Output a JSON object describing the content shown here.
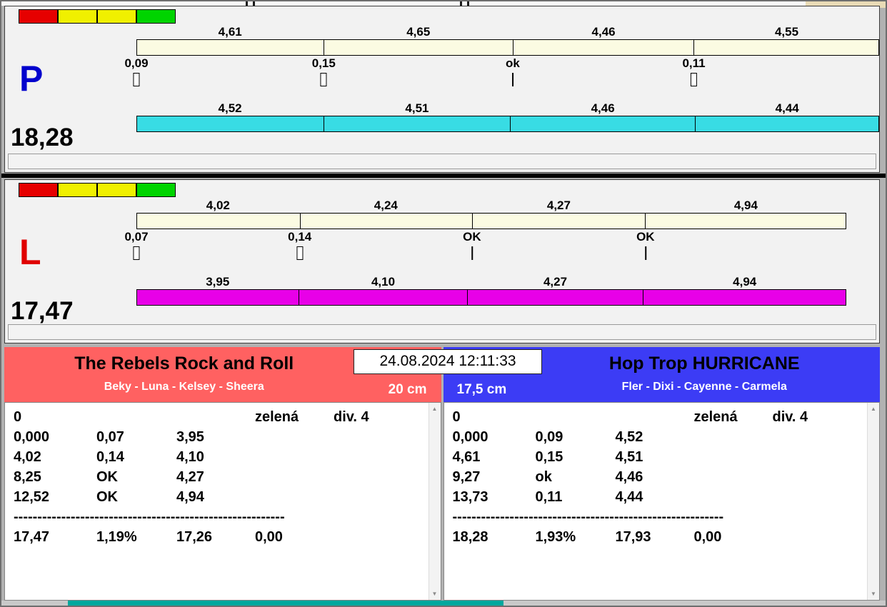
{
  "chrome": {
    "timestamp": "24.08.2024 12:11:33"
  },
  "max_total": 18.28,
  "lanes": [
    {
      "letter": "P",
      "letter_color": "#0101cd",
      "total_display": "18,28",
      "total": 18.28,
      "split_bar_color": "#fbfbe2",
      "dog_bar_color": "#38dce4",
      "status_colors": [
        "#e60000",
        "#f0f000",
        "#f0f000",
        "#00d400"
      ],
      "splits": [
        {
          "label": "4,61",
          "value": 4.61
        },
        {
          "label": "4,65",
          "value": 4.65
        },
        {
          "label": "4,46",
          "value": 4.46
        },
        {
          "label": "4,55",
          "value": 4.55
        }
      ],
      "changes": [
        {
          "label": "0,09",
          "tick": "box"
        },
        {
          "label": "0,15",
          "tick": "box"
        },
        {
          "label": "ok",
          "tick": "line"
        },
        {
          "label": "0,11",
          "tick": "box"
        }
      ],
      "dogs": [
        {
          "label": "4,52",
          "value": 4.52
        },
        {
          "label": "4,51",
          "value": 4.51
        },
        {
          "label": "4,46",
          "value": 4.46
        },
        {
          "label": "4,44",
          "value": 4.44
        }
      ]
    },
    {
      "letter": "L",
      "letter_color": "#e00000",
      "total_display": "17,47",
      "total": 17.47,
      "split_bar_color": "#fbfbe2",
      "dog_bar_color": "#e800e8",
      "status_colors": [
        "#e60000",
        "#f0f000",
        "#f0f000",
        "#00d400"
      ],
      "splits": [
        {
          "label": "4,02",
          "value": 4.02
        },
        {
          "label": "4,24",
          "value": 4.24
        },
        {
          "label": "4,27",
          "value": 4.27
        },
        {
          "label": "4,94",
          "value": 4.94
        }
      ],
      "changes": [
        {
          "label": "0,07",
          "tick": "box"
        },
        {
          "label": "0,14",
          "tick": "box"
        },
        {
          "label": "OK",
          "tick": "line"
        },
        {
          "label": "OK",
          "tick": "line"
        }
      ],
      "dogs": [
        {
          "label": "3,95",
          "value": 3.95
        },
        {
          "label": "4,10",
          "value": 4.1
        },
        {
          "label": "4,27",
          "value": 4.27
        },
        {
          "label": "4,94",
          "value": 4.94
        }
      ]
    }
  ],
  "teams": [
    {
      "name": "The Rebels Rock and Roll",
      "members": "Beky - Luna - Kelsey - Sheera",
      "height": "20 cm",
      "header_color": "#ff6161",
      "table": {
        "info": {
          "c1": "0",
          "c4": "zelená",
          "c5": "div. 4"
        },
        "rows": [
          [
            "0,000",
            "0,07",
            "3,95"
          ],
          [
            "4,02",
            "0,14",
            "4,10"
          ],
          [
            "8,25",
            "OK",
            "4,27"
          ],
          [
            "12,52",
            "OK",
            "4,94"
          ]
        ],
        "divider": "---------------------------------------------------------",
        "totals": [
          "17,47",
          "1,19%",
          "17,26",
          "0,00"
        ]
      }
    },
    {
      "name": "Hop Trop HURRICANE",
      "members": "Fler - Dixi - Cayenne - Carmela",
      "height": "17,5 cm",
      "header_color": "#3c3cf5",
      "table": {
        "info": {
          "c1": "0",
          "c4": "zelená",
          "c5": "div. 4"
        },
        "rows": [
          [
            "0,000",
            "0,09",
            "4,52"
          ],
          [
            "4,61",
            "0,15",
            "4,51"
          ],
          [
            "9,27",
            "ok",
            "4,46"
          ],
          [
            "13,73",
            "0,11",
            "4,44"
          ]
        ],
        "divider": "---------------------------------------------------------",
        "totals": [
          "18,28",
          "1,93%",
          "17,93",
          "0,00"
        ]
      }
    }
  ]
}
